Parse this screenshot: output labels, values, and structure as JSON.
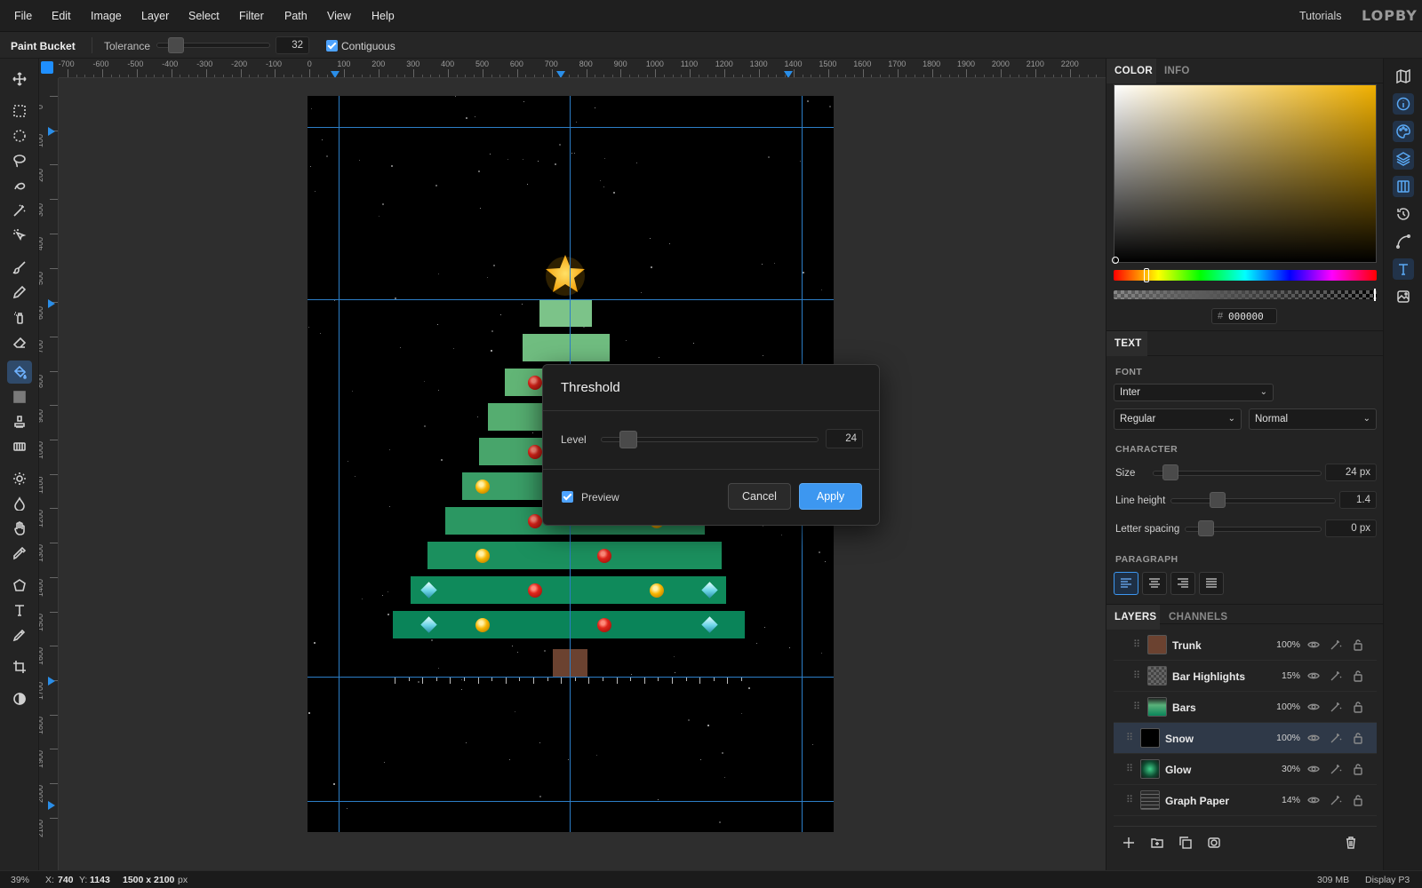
{
  "menu": {
    "items": [
      "File",
      "Edit",
      "Image",
      "Layer",
      "Select",
      "Filter",
      "Path",
      "View",
      "Help"
    ],
    "tutorials": "Tutorials",
    "logo": "LOPBY"
  },
  "options": {
    "tool_name": "Paint Bucket",
    "tolerance_label": "Tolerance",
    "tolerance_value": "32",
    "contiguous_label": "Contiguous",
    "contiguous_checked": true
  },
  "toolbar": {
    "tools": [
      "move",
      "rect-select",
      "ellipse-select",
      "lasso",
      "quick-select",
      "magic-wand",
      "auto-select",
      "brush",
      "pencil",
      "spray",
      "eraser",
      "paint-bucket",
      "gradient",
      "stamp",
      "pattern",
      "brightness",
      "blur",
      "hand",
      "eyedropper",
      "polygon",
      "text",
      "pen",
      "crop",
      "contrast"
    ],
    "active_tool": "paint-bucket"
  },
  "rulers": {
    "horizontal": [
      "-700",
      "-600",
      "-500",
      "-400",
      "-300",
      "-200",
      "-100",
      "0",
      "100",
      "200",
      "300",
      "400",
      "500",
      "600",
      "700",
      "800",
      "900",
      "1000",
      "1100",
      "1200",
      "1300",
      "1400",
      "1500",
      "1600",
      "1700",
      "1800",
      "1900",
      "2000",
      "2100",
      "2200"
    ],
    "vertical": [
      "0",
      "100",
      "200",
      "300",
      "400",
      "500",
      "600",
      "700",
      "800",
      "900",
      "1000",
      "1100",
      "1200",
      "1300",
      "1400",
      "1500",
      "1600",
      "1700",
      "1800",
      "1900",
      "2000",
      "2100"
    ]
  },
  "dialog": {
    "title": "Threshold",
    "level_label": "Level",
    "level_value": "24",
    "preview_label": "Preview",
    "preview_checked": true,
    "cancel_label": "Cancel",
    "apply_label": "Apply"
  },
  "color_panel": {
    "tabs": [
      "COLOR",
      "INFO"
    ],
    "active_tab": "COLOR",
    "hex_prefix": "#",
    "hex_value": "000000",
    "gradient_hue_color": "#f0b000"
  },
  "text_panel": {
    "title": "TEXT",
    "font_label": "FONT",
    "font_family": "Inter",
    "font_weight": "Regular",
    "font_style": "Normal",
    "character_label": "CHARACTER",
    "size_label": "Size",
    "size_value": "24 px",
    "line_height_label": "Line height",
    "line_height_value": "1.4",
    "letter_spacing_label": "Letter spacing",
    "letter_spacing_value": "0 px",
    "paragraph_label": "PARAGRAPH",
    "alignments": [
      "left",
      "center",
      "right",
      "justify"
    ],
    "active_alignment": "left"
  },
  "layers_panel": {
    "tabs": [
      "LAYERS",
      "CHANNELS"
    ],
    "active_tab": "LAYERS",
    "layers": [
      {
        "name": "Trunk",
        "opacity": "100%"
      },
      {
        "name": "Bar Highlights",
        "opacity": "15%"
      },
      {
        "name": "Bars",
        "opacity": "100%"
      },
      {
        "name": "Snow",
        "opacity": "100%",
        "selected": true
      },
      {
        "name": "Glow",
        "opacity": "30%"
      },
      {
        "name": "Graph Paper",
        "opacity": "14%"
      }
    ]
  },
  "status": {
    "zoom": "39%",
    "coords_x_label": "X:",
    "coords_x": "740",
    "coords_y_label": "Y:",
    "coords_y": "1143",
    "doc_size": "1500 x 2100",
    "doc_unit": "px",
    "memory": "309 MB",
    "color_profile": "Display P3"
  },
  "colors": {
    "accent": "#3d97f0",
    "guide": "#2c7ec7",
    "tree_light": "#7bc389",
    "tree_dark": "#0a8a5c",
    "trunk": "#6b4230",
    "star": "#ffb400"
  }
}
